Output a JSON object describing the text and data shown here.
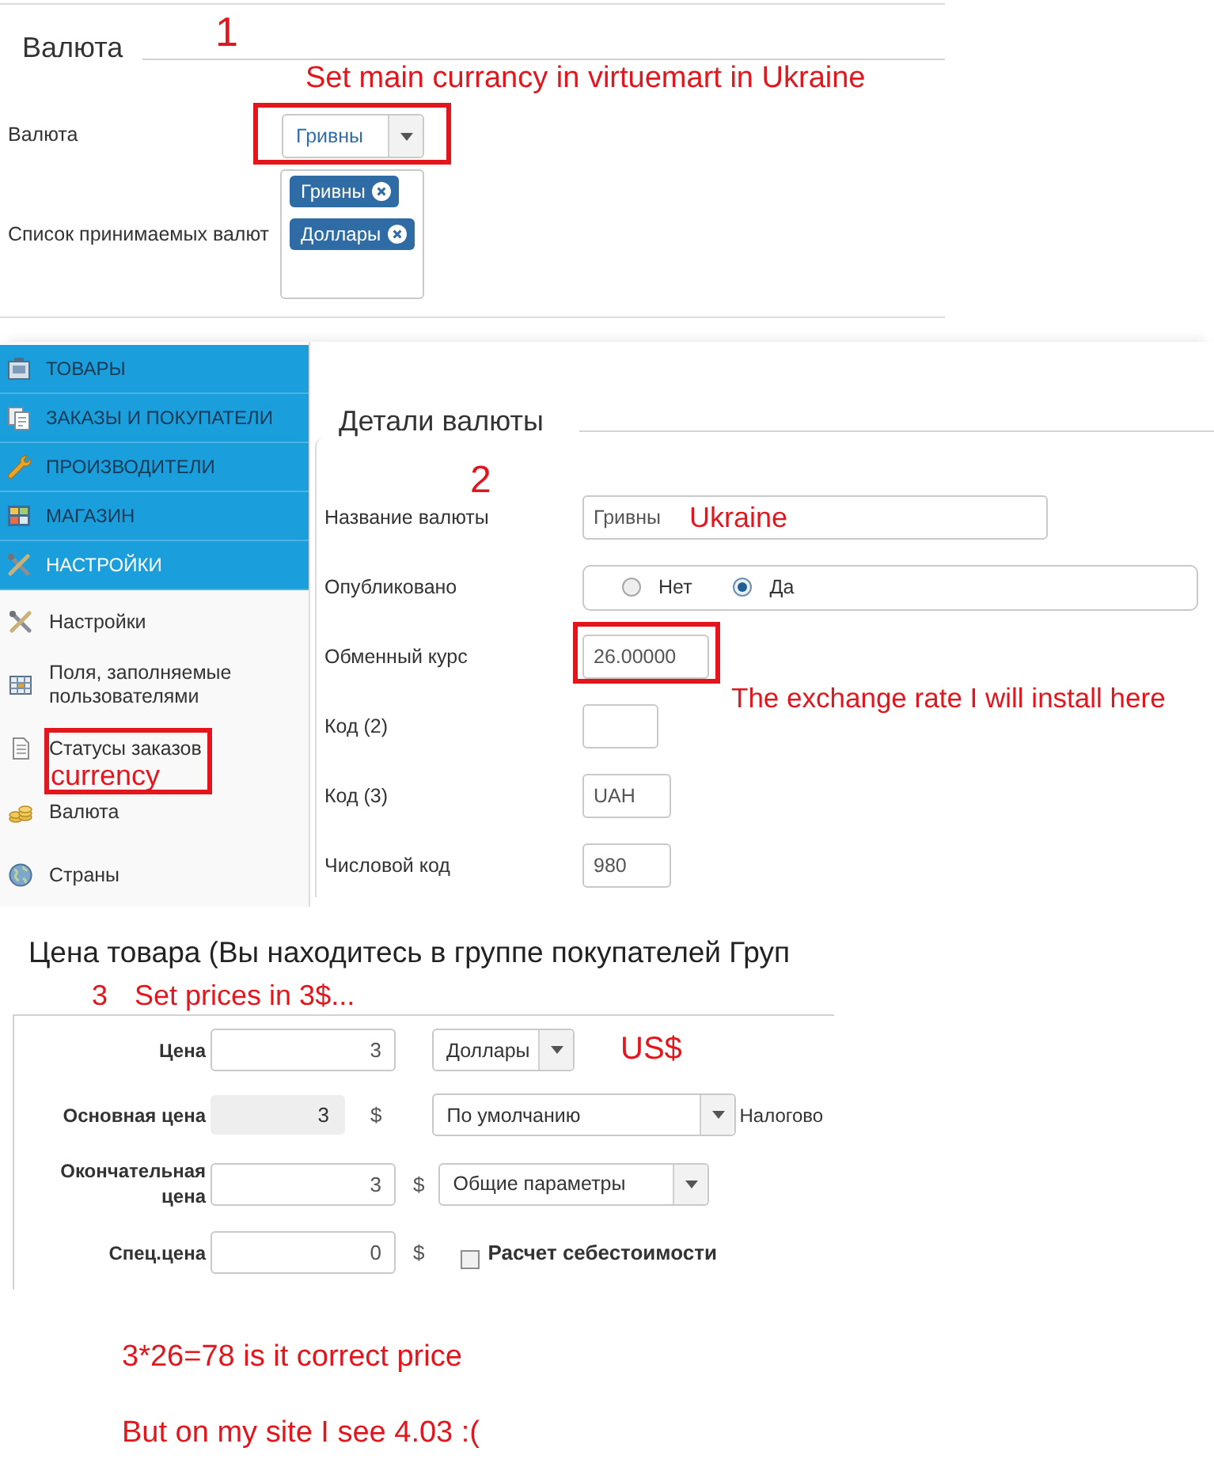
{
  "currency_settings": {
    "step": "1",
    "title": "Валюта",
    "annotation": "Set main currancy in virtuemart in Ukraine",
    "main_currency": {
      "label": "Валюта",
      "value": "Гривны",
      "highlighted": true
    },
    "accepted_currencies": {
      "label": "Список принимаемых валют",
      "tags": [
        "Гривны",
        "Доллары"
      ]
    }
  },
  "admin_screen": {
    "step": "2",
    "menu": {
      "sections": [
        {
          "label": "ТОВАРЫ",
          "selected": false
        },
        {
          "label": "ЗАКАЗЫ И ПОКУПАТЕЛИ",
          "selected": false
        },
        {
          "label": "ПРОИЗВОДИТЕЛИ",
          "selected": false
        },
        {
          "label": "МАГАЗИН",
          "selected": false
        },
        {
          "label": "НАСТРОЙКИ",
          "selected": true
        }
      ],
      "items": [
        {
          "label": "Настройки",
          "highlighted": false
        },
        {
          "label": "Поля, заполняемые пользователями",
          "highlighted": false
        },
        {
          "label": "Статусы заказов",
          "highlighted": true,
          "annotation": "currency"
        },
        {
          "label": "Валюта",
          "highlighted": false
        },
        {
          "label": "Страны",
          "highlighted": false
        }
      ]
    },
    "details": {
      "title": "Детали валюты",
      "annotation": "The exchange rate I will install here",
      "fields": [
        {
          "kind": "text",
          "label": "Название валюты",
          "value": "Гривны",
          "annotation": "Ukraine",
          "highlighted": false
        },
        {
          "kind": "radio",
          "label": "Опубликовано",
          "options": [
            {
              "label": "Нет",
              "selected": false
            },
            {
              "label": "Да",
              "selected": true
            }
          ],
          "highlighted": false
        },
        {
          "kind": "text",
          "label": "Обменный курс",
          "value": "26.00000",
          "highlighted": true
        },
        {
          "kind": "text",
          "label": "Код (2)",
          "highlighted": false
        },
        {
          "kind": "text",
          "label": "Код (3)",
          "value": "UAH",
          "highlighted": false
        },
        {
          "kind": "text",
          "label": "Числовой код",
          "value": "980",
          "highlighted": false
        }
      ]
    }
  },
  "price_panel": {
    "title": "Цена товара (Вы находитесь в группе покупателей Груп",
    "step": "3",
    "annotation": "Set prices in 3$...",
    "rows": [
      {
        "kind": "input",
        "label": "Цена",
        "value": "3",
        "select": "Доллары",
        "annotation": "US$"
      },
      {
        "kind": "readonly",
        "label": "Основная цена",
        "value": "3",
        "unit": "$",
        "select": "По умолчанию",
        "trailing": "Налогово"
      },
      {
        "kind": "input",
        "label": "Окончательная цена",
        "value": "3",
        "unit": "$",
        "select": "Общие параметры"
      },
      {
        "kind": "input",
        "label": "Спец.цена",
        "value": "0",
        "unit": "$",
        "checkbox": {
          "label": "Расчет себестоимости",
          "checked": false
        }
      }
    ]
  },
  "notes": [
    "3*26=78 is it correct price",
    "But on my site I see 4.03 :("
  ]
}
